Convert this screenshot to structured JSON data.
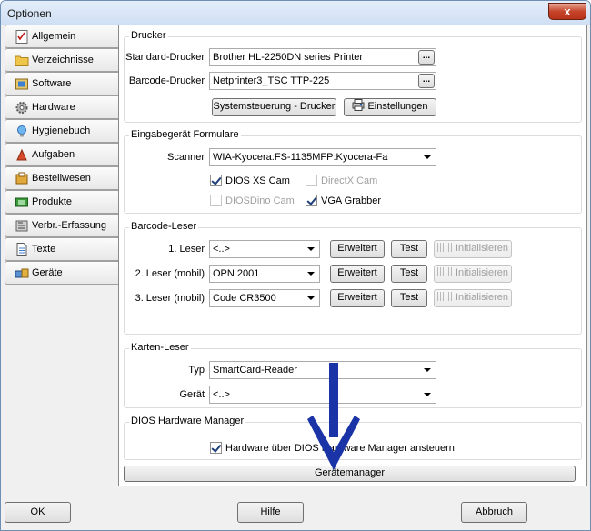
{
  "window": {
    "title": "Optionen",
    "close_symbol": "x"
  },
  "tabs": [
    {
      "label": "Allgemein",
      "icon": "checklist-icon",
      "active": false
    },
    {
      "label": "Verzeichnisse",
      "icon": "folder-icon",
      "active": false
    },
    {
      "label": "Software",
      "icon": "software-box-icon",
      "active": false
    },
    {
      "label": "Hardware",
      "icon": "gear-icon",
      "active": true
    },
    {
      "label": "Hygienebuch",
      "icon": "lightbulb-icon",
      "active": false
    },
    {
      "label": "Aufgaben",
      "icon": "tasks-icon",
      "active": false
    },
    {
      "label": "Bestellwesen",
      "icon": "order-icon",
      "active": false
    },
    {
      "label": "Produkte",
      "icon": "product-icon",
      "active": false
    },
    {
      "label": "Verbr.-Erfassung",
      "icon": "consumption-icon",
      "active": false
    },
    {
      "label": "Texte",
      "icon": "document-icon",
      "active": false
    },
    {
      "label": "Geräte",
      "icon": "devices-icon",
      "active": false
    }
  ],
  "drucker": {
    "title": "Drucker",
    "standard_label": "Standard-Drucker",
    "standard_value": "Brother HL-2250DN series Printer",
    "barcode_label": "Barcode-Drucker",
    "barcode_value": "Netprinter3_TSC TTP-225",
    "dots": "...",
    "systemsteuerung_button": "Systemsteuerung - Drucker",
    "einstellungen_button": "Einstellungen"
  },
  "eingabe": {
    "title": "Eingabegerät Formulare",
    "scanner_label": "Scanner",
    "scanner_value": "WIA-Kyocera:FS-1135MFP:Kyocera-Fa",
    "checkboxes": [
      {
        "label": "DIOS XS Cam",
        "checked": true,
        "enabled": true
      },
      {
        "label": "DirectX Cam",
        "checked": false,
        "enabled": false
      },
      {
        "label": "DIOSDino Cam",
        "checked": false,
        "enabled": false
      },
      {
        "label": "VGA Grabber",
        "checked": true,
        "enabled": true
      }
    ]
  },
  "barcode_leser": {
    "title": "Barcode-Leser",
    "rows": [
      {
        "label": "1. Leser",
        "value": "<..>"
      },
      {
        "label": "2. Leser (mobil)",
        "value": "OPN 2001"
      },
      {
        "label": "3. Leser (mobil)",
        "value": "Code CR3500"
      }
    ],
    "erweitert_button": "Erweitert",
    "test_button": "Test",
    "initialisieren_button": "Initialisieren"
  },
  "karten_leser": {
    "title": "Karten-Leser",
    "typ_label": "Typ",
    "typ_value": "SmartCard-Reader",
    "geraet_label": "Gerät",
    "geraet_value": "<..>"
  },
  "hw_manager": {
    "title": "DIOS Hardware Manager",
    "checkbox_label": "Hardware über DIOS Hardware Manager ansteuern",
    "checked": true
  },
  "geraetemanager_button": "Gerätemanager",
  "footer": {
    "ok": "OK",
    "hilfe": "Hilfe",
    "abbruch": "Abbruch"
  },
  "annotation": {
    "arrow_color": "#1a33a6"
  }
}
